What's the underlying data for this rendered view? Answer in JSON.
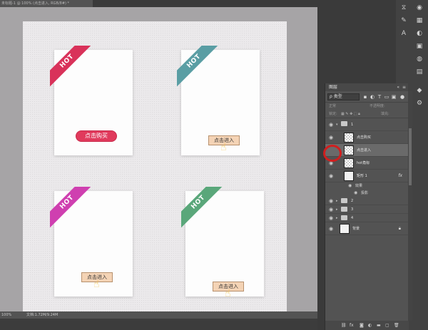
{
  "document": {
    "tab_title": "未标题-1 @ 100% (点击进入, RGB/8#) *",
    "zoom": "100%",
    "doc_size": "文档:1.72M/9.24M"
  },
  "canvas": {
    "cards": [
      {
        "hot_label": "HOT",
        "ribbon_color": "#d9325a",
        "button": "点击购买",
        "button_type": "buy"
      },
      {
        "hot_label": "HOT",
        "ribbon_color": "#5a9ea4",
        "button": "点击进入",
        "button_type": "enter"
      },
      {
        "hot_label": "HOT",
        "ribbon_color": "#cf3fb0",
        "button": "点击进入",
        "button_type": "enter"
      },
      {
        "hot_label": "HOT",
        "ribbon_color": "#5aa77a",
        "button": "点击进入",
        "button_type": "enter"
      }
    ]
  },
  "layers_panel": {
    "title": "图层",
    "filter_kind": "类型",
    "blend_mode": "正常",
    "opacity_label": "不透明度:",
    "lock_label": "锁定:",
    "fill_label": "填充:",
    "layers": [
      {
        "name": "1",
        "type": "group",
        "expanded": true
      },
      {
        "name": "点击购买",
        "type": "layer"
      },
      {
        "name": "点击进入",
        "type": "layer",
        "selected": true
      },
      {
        "name": "hot角标",
        "type": "layer"
      },
      {
        "name": "矩形 1",
        "type": "shape",
        "fx": "fx"
      },
      {
        "name": "效果",
        "type": "effect"
      },
      {
        "name": "投影",
        "type": "effect"
      },
      {
        "name": "2",
        "type": "group"
      },
      {
        "name": "3",
        "type": "group"
      },
      {
        "name": "4",
        "type": "group"
      },
      {
        "name": "背景",
        "type": "background"
      }
    ]
  },
  "colors": {
    "workspace": "#a6a4a6",
    "panel": "#535353",
    "accent_circle": "#d01e1e"
  }
}
